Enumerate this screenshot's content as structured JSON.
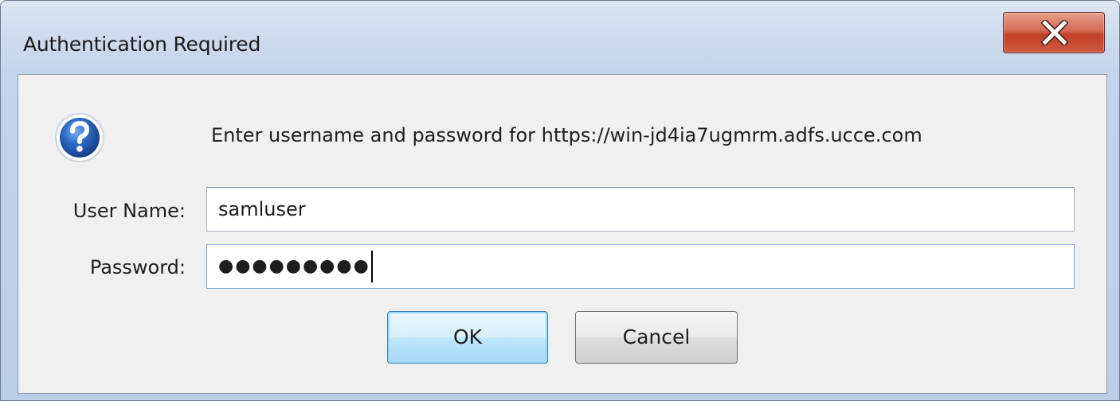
{
  "window": {
    "title": "Authentication Required",
    "close_glyph": "X"
  },
  "dialog": {
    "icon": "question-help-icon",
    "prompt": "Enter username and password for https://win-jd4ia7ugmrm.adfs.ucce.com",
    "username_label": "User Name:",
    "username_value": "samluser",
    "password_label": "Password:",
    "password_value_masked": "●●●●●●●●●",
    "ok_label": "OK",
    "cancel_label": "Cancel"
  },
  "colors": {
    "close_button": "#c2402a",
    "help_icon": "#2b5fb5",
    "ok_focus_border": "#3c7fb1"
  }
}
